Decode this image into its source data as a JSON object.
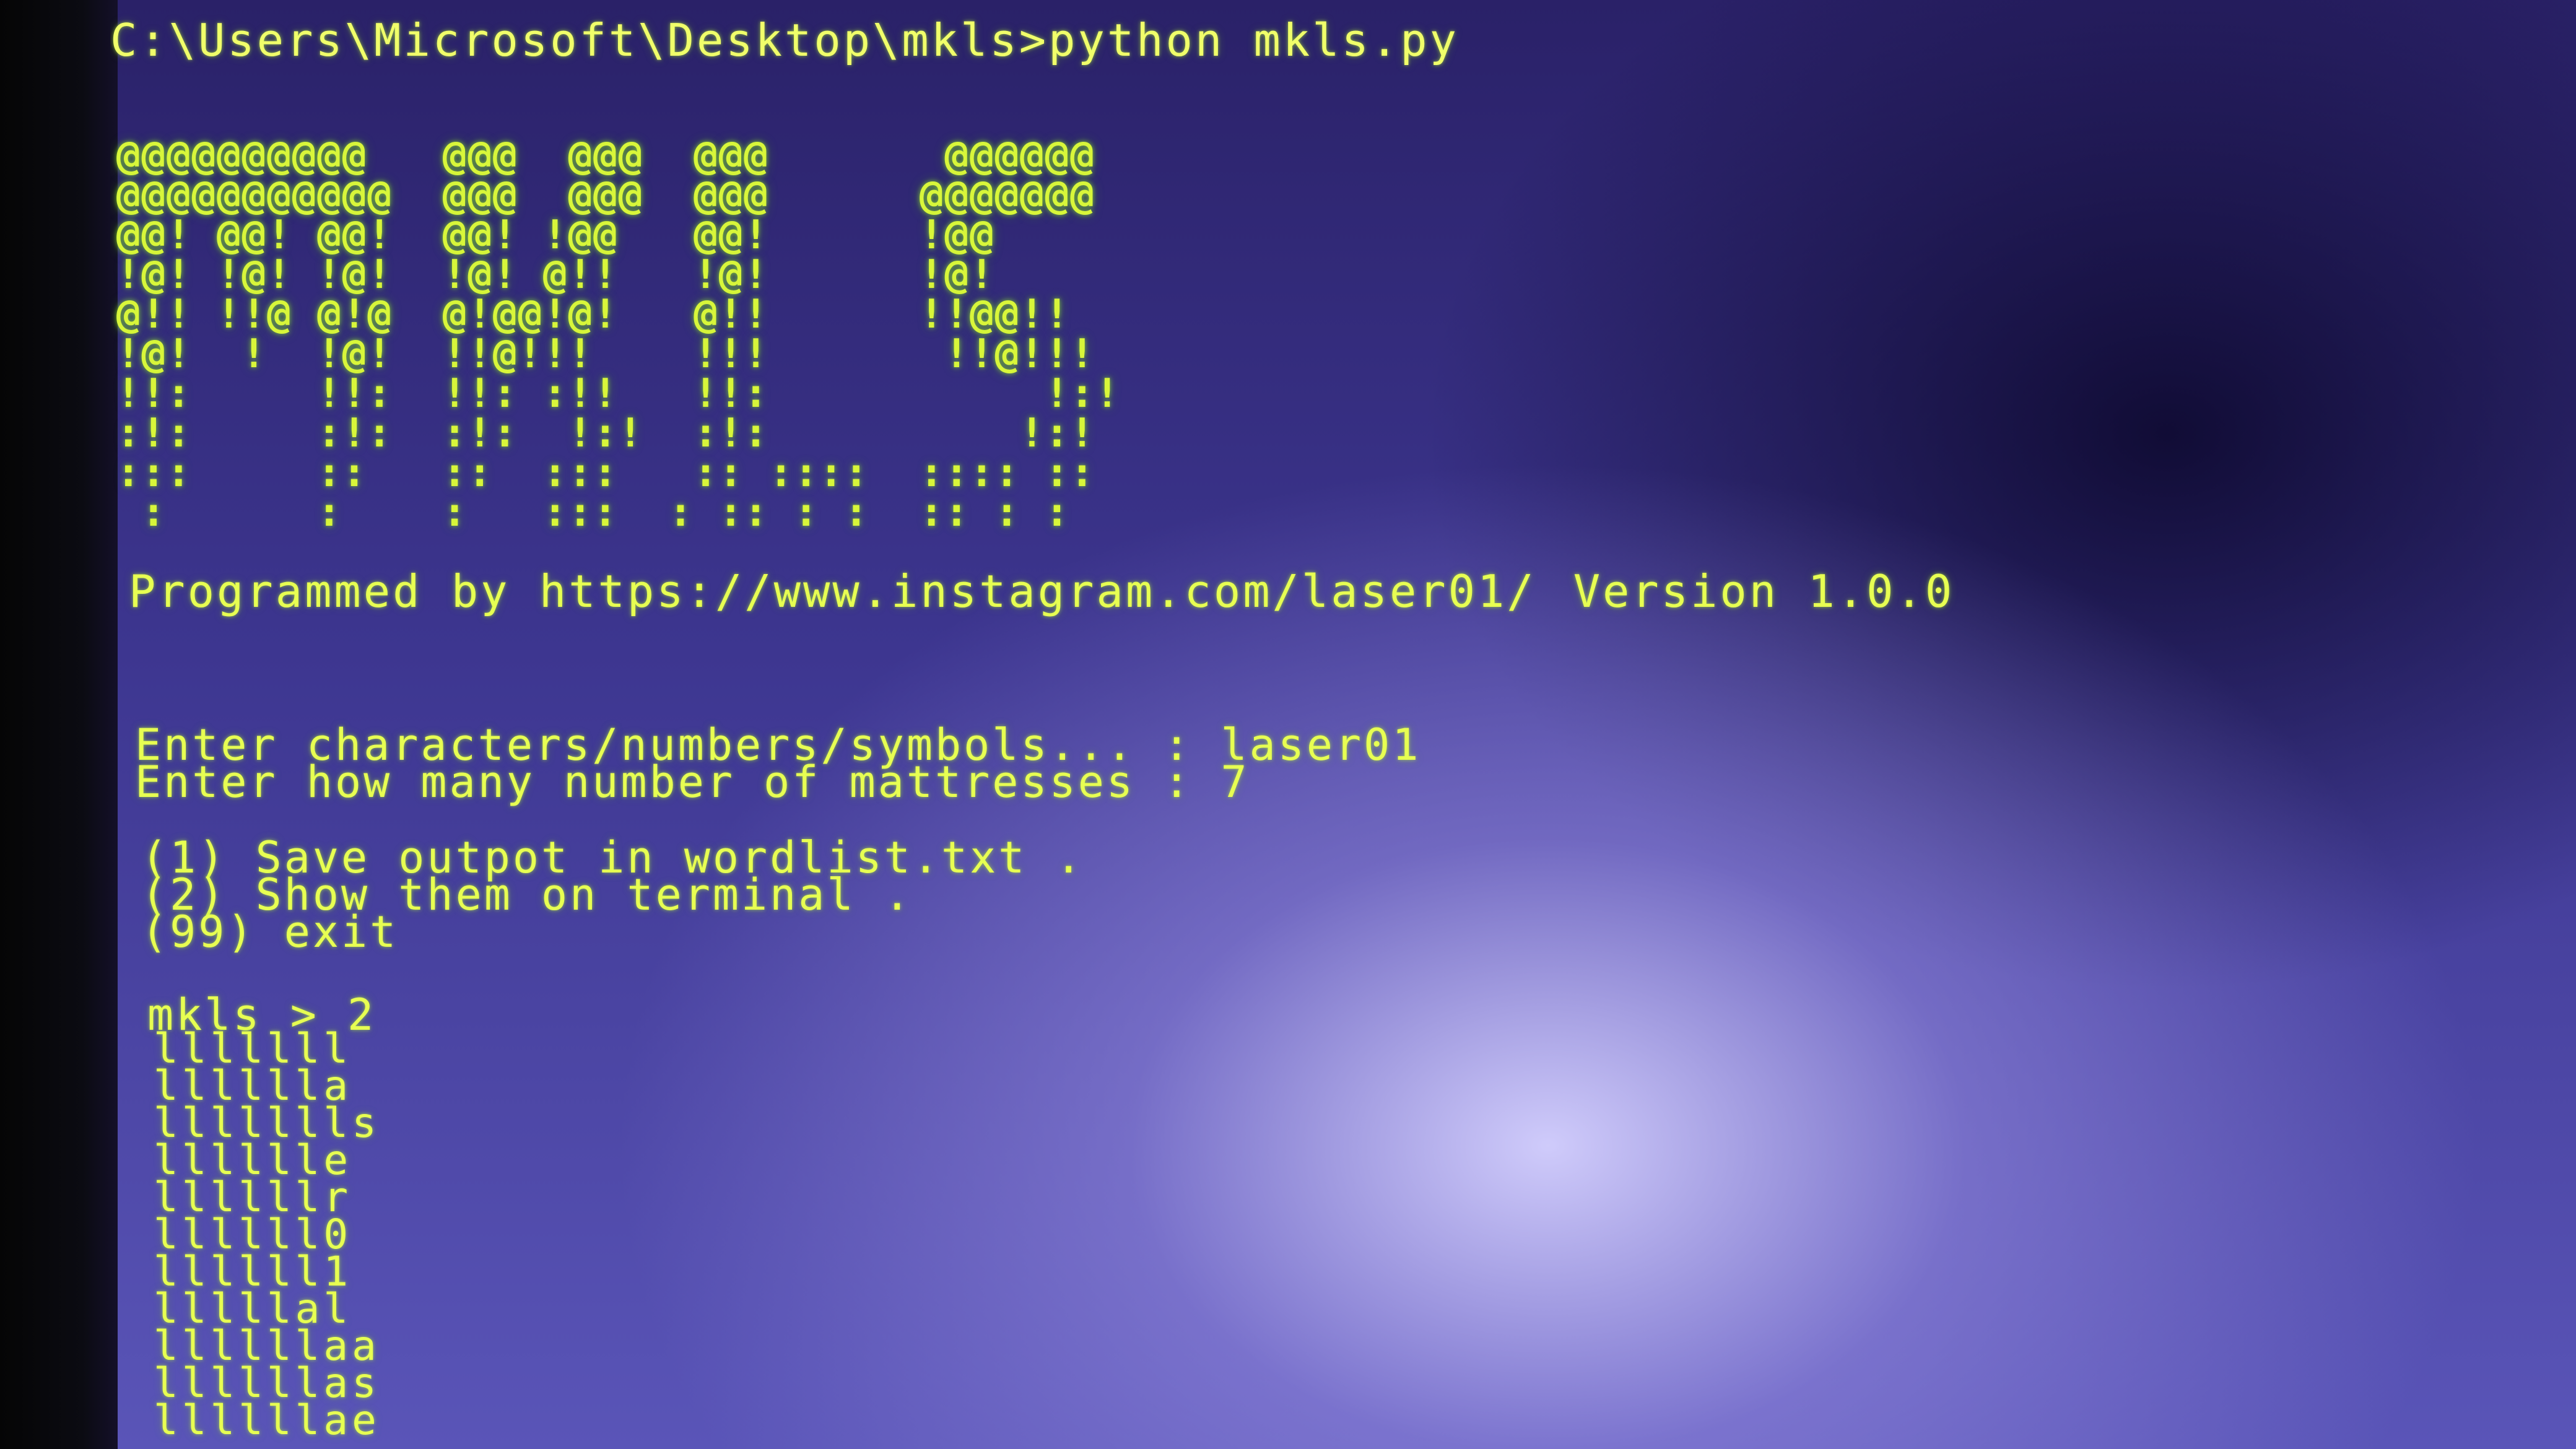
{
  "terminal": {
    "command_line": "C:\\Users\\Microsoft\\Desktop\\mkls>python mkls.py",
    "banner_art": "@@@@@@@@@@   @@@  @@@  @@@       @@@@@@\n@@@@@@@@@@@  @@@  @@@  @@@      @@@@@@@\n@@! @@! @@!  @@! !@@   @@!      !@@\n!@! !@! !@!  !@! @!!   !@!      !@!\n@!! !!@ @!@  @!@@!@!   @!!      !!@@!!\n!@!  !  !@!  !!@!!!    !!!       !!@!!!\n!!:     !!:  !!: :!!   !!:           !:!\n:!:     :!:  :!:  !:!  :!:          !:!\n:::     ::   ::  :::   :: ::::  :::: ::\n :      :    :   :::  : :: : :  :: : :",
    "credit_text": "Programmed by https://www.instagram.com/laser01/",
    "version_text": "Version 1.0.0",
    "input_chars_prompt": "Enter characters/numbers/symbols... : laser01",
    "input_count_prompt": "Enter how many number of mattresses : 7",
    "menu": {
      "option1": "(1) Save outpot in wordlist.txt .",
      "option2": "(2) Show them on terminal .",
      "option99": "(99) exit"
    },
    "shell_prompt": "mkls > 2",
    "output_lines": [
      "lllllll",
      "lllllla",
      "llllllls",
      "lllllle",
      "llllllr",
      "llllll0",
      "llllll1",
      "lllllal",
      "llllllaa",
      "llllllas",
      "llllllae"
    ]
  },
  "colors": {
    "text": "#e7ff52",
    "background": "#3d3690"
  }
}
